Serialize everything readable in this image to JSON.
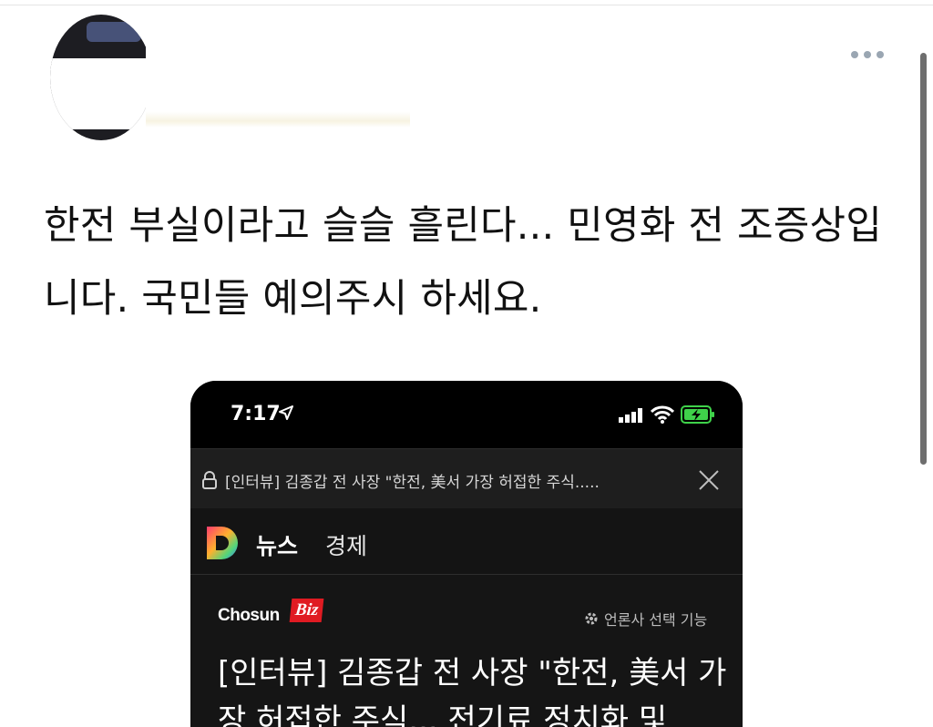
{
  "tweet": {
    "text": "한전 부실이라고 슬슬 흘린다... 민영화 전 조증상입니다. 국민들 예의주시 하세요."
  },
  "phone": {
    "status_bar": {
      "time": "7:17"
    },
    "browser": {
      "url_text": "[인터뷰] 김종갑 전 사장 \"한전, 美서 가장 허접한 주식....."
    },
    "nav": {
      "news_label": "뉴스",
      "section_label": "경제"
    },
    "article": {
      "brand_chosun": "Chosun",
      "brand_biz": "Biz",
      "media_option_label": "언론사 선택 기능",
      "title": "[인터뷰] 김종갑 전 사장 \"한전, 美서 가장 허접한 주식... 전기료 정치화 및"
    }
  },
  "colors": {
    "background": "#ffffff",
    "text": "#111111",
    "phone_bg": "#101010",
    "brand_red": "#e01b22",
    "battery_green": "#3fd24a"
  },
  "icons": [
    "more-icon",
    "location-arrow-icon",
    "signal-icon",
    "wifi-icon",
    "battery-charging-icon",
    "lock-icon",
    "close-icon",
    "daum-logo-icon",
    "gear-icon"
  ]
}
